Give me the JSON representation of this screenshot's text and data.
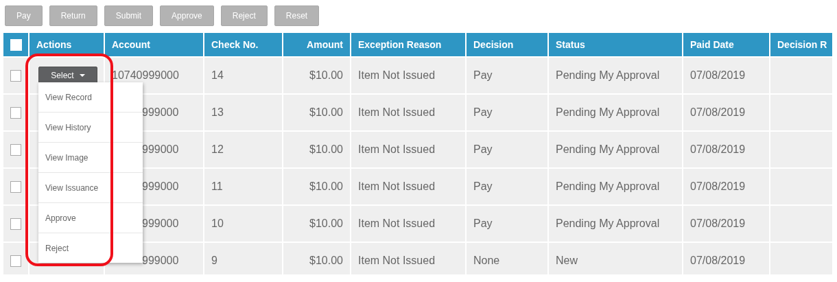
{
  "toolbar": {
    "buttons": [
      {
        "label": "Pay",
        "disabled": true
      },
      {
        "label": "Return",
        "disabled": true
      },
      {
        "label": "Submit",
        "disabled": true
      },
      {
        "label": "Approve",
        "disabled": true
      },
      {
        "label": "Reject",
        "disabled": true
      },
      {
        "label": "Reset",
        "disabled": true
      }
    ]
  },
  "table": {
    "select_all": {
      "checked": false
    },
    "columns": [
      "Actions",
      "Account",
      "Check No.",
      "Amount",
      "Exception Reason",
      "Decision",
      "Status",
      "Paid Date",
      "Decision R"
    ],
    "actions_menu": {
      "button": "Select",
      "expanded": true,
      "items": [
        "View Record",
        "View History",
        "View Image",
        "View Issuance",
        "Approve",
        "Reject"
      ]
    },
    "rows": [
      {
        "checked": false,
        "account": "10740999000",
        "check_no": "14",
        "amount": "$10.00",
        "exception_reason": "Item Not Issued",
        "decision": "Pay",
        "status": "Pending My Approval",
        "paid_date": "07/08/2019"
      },
      {
        "checked": false,
        "account": "999000",
        "check_no": "13",
        "amount": "$10.00",
        "exception_reason": "Item Not Issued",
        "decision": "Pay",
        "status": "Pending My Approval",
        "paid_date": "07/08/2019"
      },
      {
        "checked": false,
        "account": "999000",
        "check_no": "12",
        "amount": "$10.00",
        "exception_reason": "Item Not Issued",
        "decision": "Pay",
        "status": "Pending My Approval",
        "paid_date": "07/08/2019"
      },
      {
        "checked": false,
        "account": "999000",
        "check_no": "11",
        "amount": "$10.00",
        "exception_reason": "Item Not Issued",
        "decision": "Pay",
        "status": "Pending My Approval",
        "paid_date": "07/08/2019"
      },
      {
        "checked": false,
        "account": "999000",
        "check_no": "10",
        "amount": "$10.00",
        "exception_reason": "Item Not Issued",
        "decision": "Pay",
        "status": "Pending My Approval",
        "paid_date": "07/08/2019"
      },
      {
        "checked": false,
        "account": "999000",
        "check_no": "9",
        "amount": "$10.00",
        "exception_reason": "Item Not Issued",
        "decision": "None",
        "status": "New",
        "paid_date": "07/08/2019"
      }
    ]
  }
}
